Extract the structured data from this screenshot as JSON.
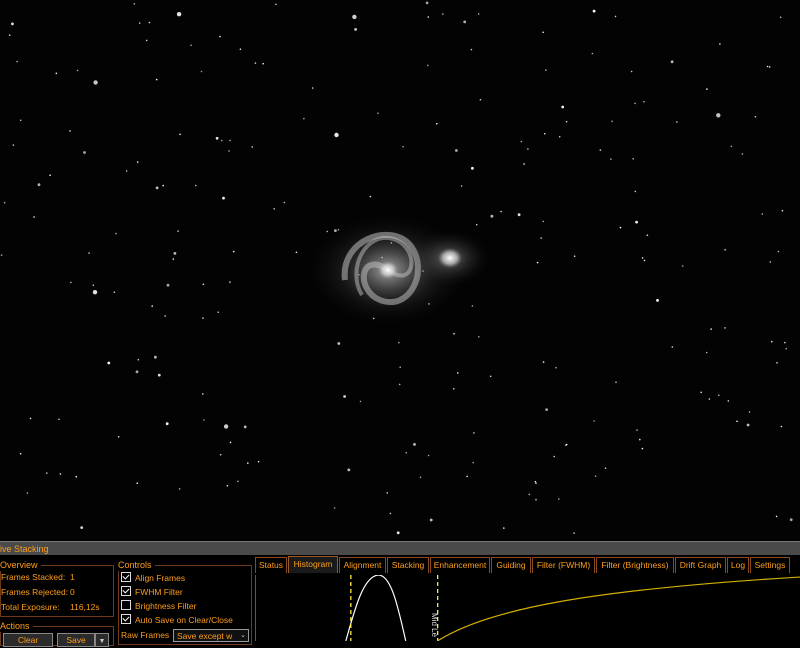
{
  "panel": {
    "title": "ive Stacking"
  },
  "overview": {
    "title": "Overview",
    "frames_stacked_label": "Frames Stacked:",
    "frames_stacked_value": "1",
    "frames_rejected_label": "Frames Rejected:",
    "frames_rejected_value": "0",
    "total_exposure_label": "Total Exposure:",
    "total_exposure_value": "116,12s"
  },
  "actions": {
    "title": "Actions",
    "clear_label": "Clear",
    "save_label": "Save"
  },
  "controls": {
    "title": "Controls",
    "align_frames": {
      "label": "Align Frames",
      "checked": true
    },
    "fwhm_filter": {
      "label": "FWHM Filter",
      "checked": true
    },
    "brightness_filter": {
      "label": "Brightness Filter",
      "checked": false
    },
    "auto_save": {
      "label": "Auto Save on Clear/Close",
      "checked": true
    },
    "raw_frames_label": "Raw Frames",
    "raw_frames_value": "Save except w"
  },
  "tabs": [
    {
      "label": "Status",
      "active": false
    },
    {
      "label": "Histogram",
      "active": true
    },
    {
      "label": "Alignment",
      "active": false
    },
    {
      "label": "Stacking",
      "active": false
    },
    {
      "label": "Enhancement",
      "active": false
    },
    {
      "label": "Guiding",
      "active": false
    },
    {
      "label": "Filter (FWHM)",
      "active": false
    },
    {
      "label": "Filter (Brightness)",
      "active": false
    },
    {
      "label": "Drift Graph",
      "active": false
    },
    {
      "label": "Log",
      "active": false
    },
    {
      "label": "Settings",
      "active": false
    }
  ],
  "histogram": {
    "mid_label": "Mid Le",
    "curve_color": "#ffffff",
    "marker_color": "#ffeb3b",
    "stretch_color": "#d4b000"
  },
  "colors": {
    "accent": "#ff9e1b",
    "border": "#8a4a20"
  }
}
